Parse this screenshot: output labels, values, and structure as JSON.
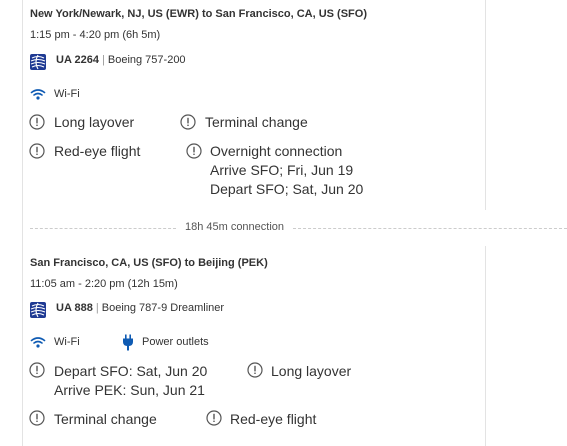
{
  "segments": [
    {
      "route": "New York/Newark, NJ, US (EWR) to San Francisco, CA, US (SFO)",
      "times": "1:15 pm - 4:20 pm (6h 5m)",
      "flight_number": "UA 2264",
      "separator": "|",
      "aircraft": "Boeing 757-200",
      "amenities": [
        "Wi-Fi"
      ],
      "warnings": {
        "long_layover": "Long layover",
        "terminal_change": "Terminal change",
        "red_eye": "Red-eye flight",
        "overnight_title": "Overnight connection",
        "overnight_arrive": "Arrive SFO; Fri, Jun 19",
        "overnight_depart": "Depart SFO; Sat, Jun 20"
      }
    },
    {
      "route": "San Francisco, CA, US (SFO) to Beijing (PEK)",
      "times": "11:05 am - 2:20 pm (12h 15m)",
      "flight_number": "UA 888",
      "separator": "|",
      "aircraft": "Boeing 787-9 Dreamliner",
      "amenities": [
        "Wi-Fi",
        "Power outlets"
      ],
      "warnings": {
        "depart": "Depart SFO: Sat, Jun 20",
        "arrive": "Arrive PEK: Sun, Jun 21",
        "long_layover": "Long layover",
        "terminal_change": "Terminal change",
        "red_eye": "Red-eye flight"
      }
    }
  ],
  "connection": "18h 45m connection",
  "icons": {
    "airline_logo": "united-globe-logo",
    "wifi": "wifi-icon",
    "power": "power-plug-icon",
    "warning": "exclamation-circle-icon"
  },
  "colors": {
    "brand_blue": "#1f3a93",
    "amenity_blue": "#0f5bb3",
    "text": "#333333",
    "divider": "#e3e3e3"
  }
}
